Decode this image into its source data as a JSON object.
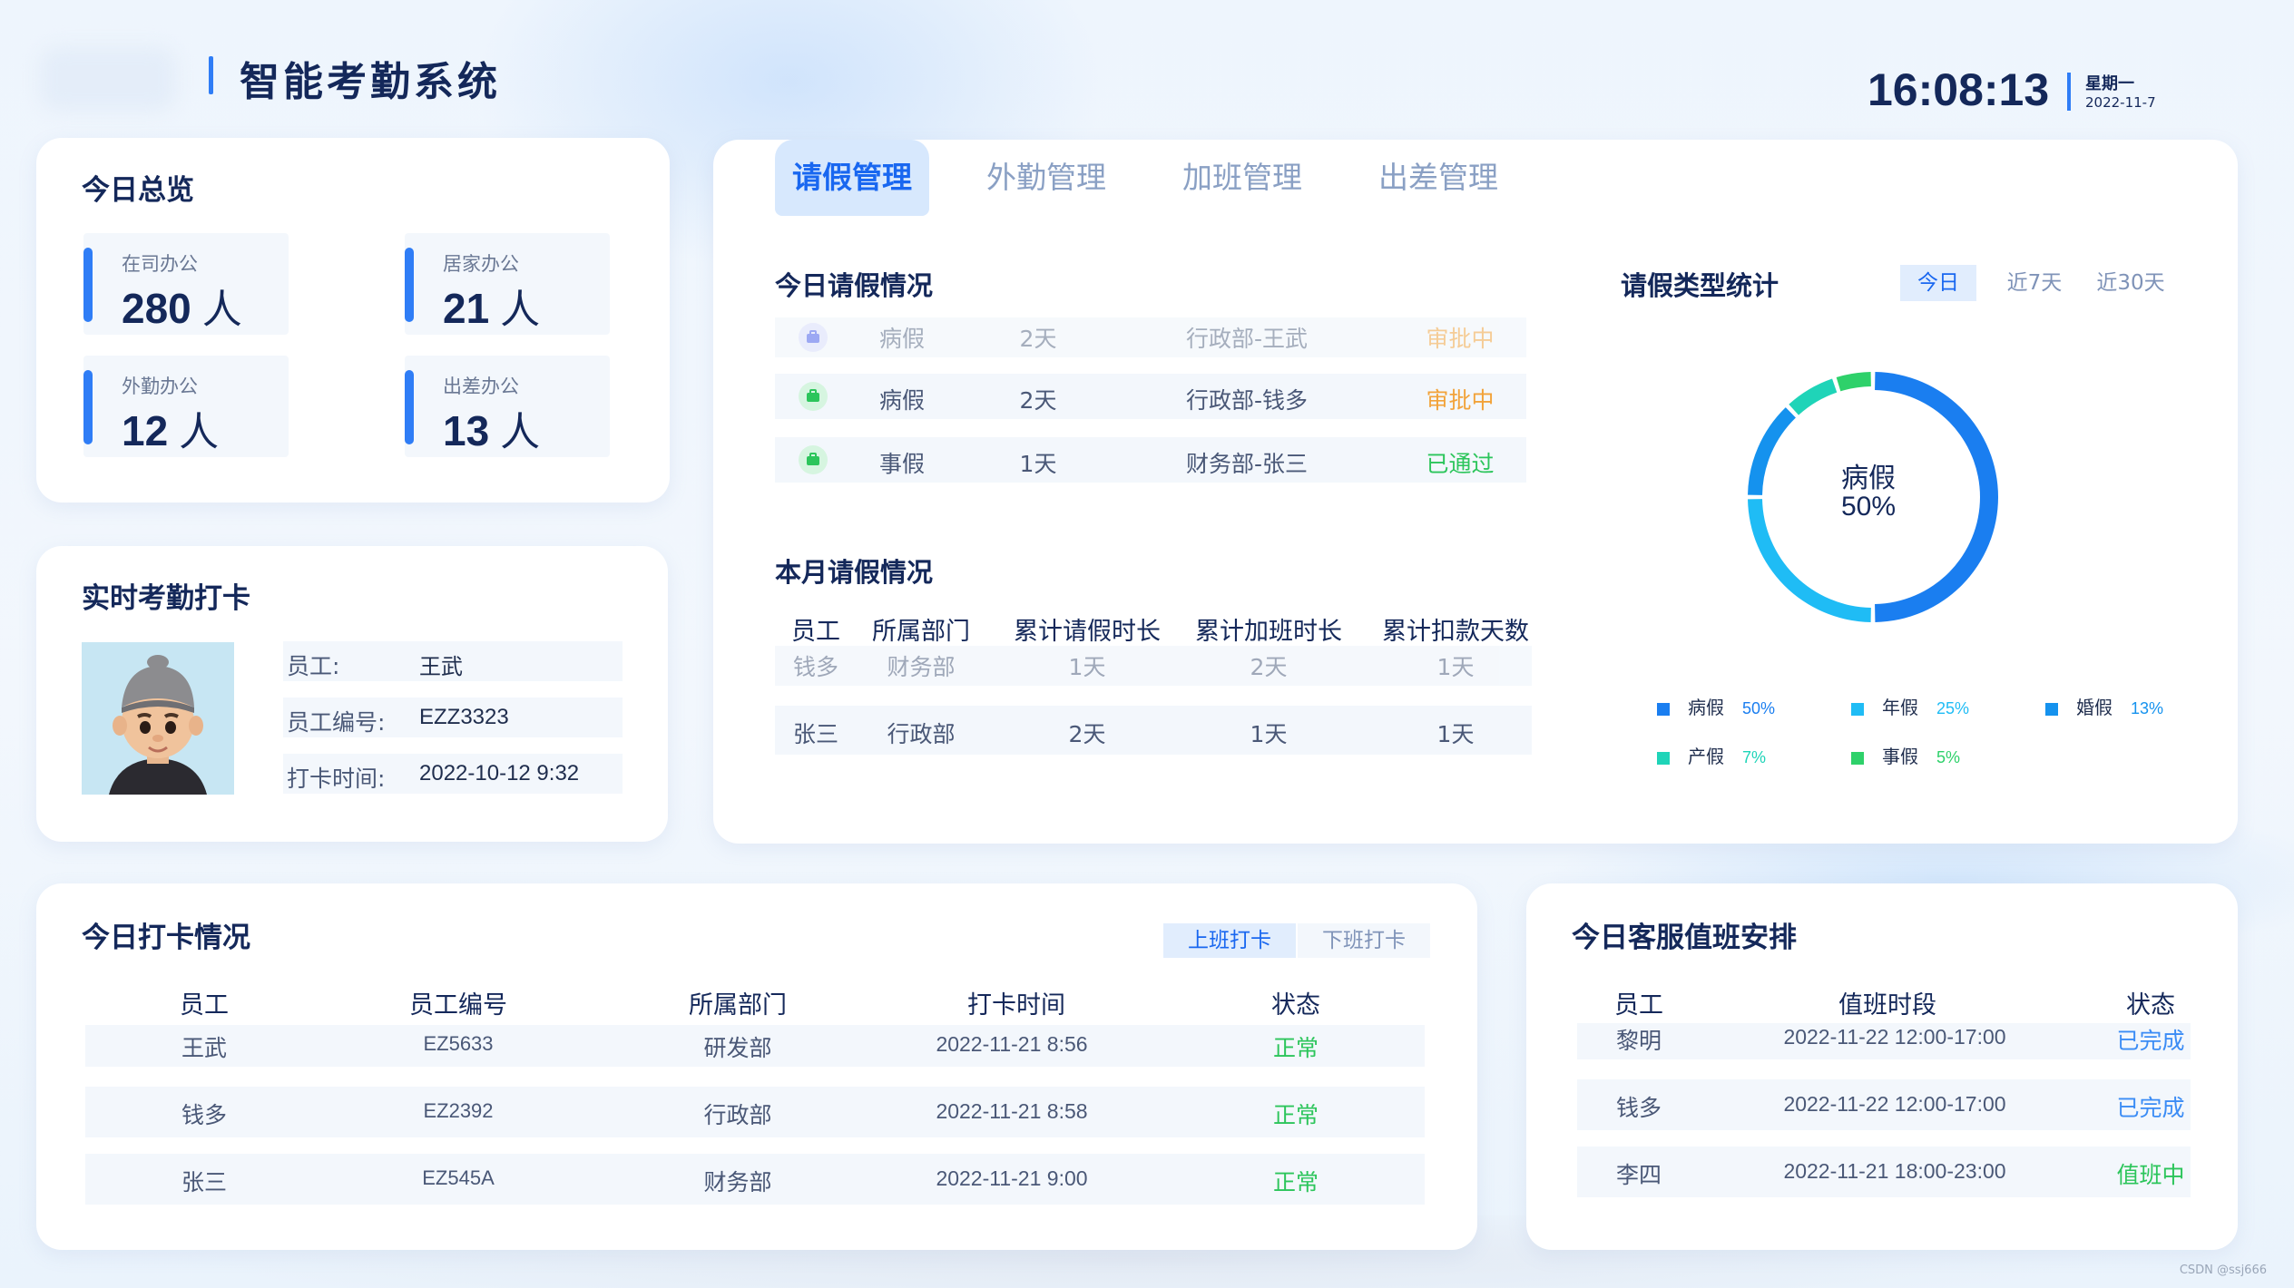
{
  "header": {
    "title": "智能考勤系统",
    "time": "16:08:13",
    "weekday": "星期一",
    "date": "2022-11-7"
  },
  "overview": {
    "title": "今日总览",
    "unit": "人",
    "stats": [
      {
        "label": "在司办公",
        "value": "280"
      },
      {
        "label": "居家办公",
        "value": "21"
      },
      {
        "label": "外勤办公",
        "value": "12"
      },
      {
        "label": "出差办公",
        "value": "13"
      }
    ]
  },
  "realtime": {
    "title": "实时考勤打卡",
    "rows": [
      {
        "key": "员工:",
        "value": "王武"
      },
      {
        "key": "员工编号:",
        "value": "EZZ3323"
      },
      {
        "key": "打卡时间:",
        "value": "2022-10-12 9:32"
      }
    ]
  },
  "tabs": [
    {
      "label": "请假管理",
      "active": true
    },
    {
      "label": "外勤管理",
      "active": false
    },
    {
      "label": "加班管理",
      "active": false
    },
    {
      "label": "出差管理",
      "active": false
    }
  ],
  "today_leave": {
    "title": "今日请假情况",
    "rows": [
      {
        "type": "病假",
        "days": "2天",
        "person": "行政部-王武",
        "status": "审批中"
      },
      {
        "type": "病假",
        "days": "2天",
        "person": "行政部-钱多",
        "status": "审批中"
      },
      {
        "type": "事假",
        "days": "1天",
        "person": "财务部-张三",
        "status": "已通过"
      }
    ]
  },
  "month_leave": {
    "title": "本月请假情况",
    "headers": [
      "员工",
      "所属部门",
      "累计请假时长",
      "累计加班时长",
      "累计扣款天数"
    ],
    "rows": [
      [
        "钱多",
        "财务部",
        "1天",
        "2天",
        "1天"
      ],
      [
        "张三",
        "行政部",
        "2天",
        "1天",
        "1天"
      ]
    ]
  },
  "leave_stats": {
    "title": "请假类型统计",
    "ranges": [
      "今日",
      "近7天",
      "近30天"
    ],
    "active_range": "今日",
    "center_label": "病假",
    "center_value": "50%"
  },
  "chart_data": {
    "type": "pie",
    "categories": [
      "病假",
      "年假",
      "婚假",
      "产假",
      "事假"
    ],
    "values": [
      50,
      25,
      13,
      7,
      5
    ],
    "labels": [
      "50%",
      "25%",
      "13%",
      "7%",
      "5%"
    ],
    "colors": [
      "#1a7ef0",
      "#1fbcf5",
      "#1592ee",
      "#1fd4b8",
      "#2ed16a"
    ],
    "legend": "bottom"
  },
  "checkin": {
    "title": "今日打卡情况",
    "toggle": [
      "上班打卡",
      "下班打卡"
    ],
    "headers": [
      "员工",
      "员工编号",
      "所属部门",
      "打卡时间",
      "状态"
    ],
    "rows": [
      [
        "王武",
        "EZ5633",
        "研发部",
        "2022-11-21 8:56",
        "正常"
      ],
      [
        "钱多",
        "EZ2392",
        "行政部",
        "2022-11-21 8:58",
        "正常"
      ],
      [
        "张三",
        "EZ545A",
        "财务部",
        "2022-11-21 9:00",
        "正常"
      ]
    ]
  },
  "duty": {
    "title": "今日客服值班安排",
    "headers": [
      "员工",
      "值班时段",
      "状态"
    ],
    "rows": [
      [
        "黎明",
        "2022-11-22 12:00-17:00",
        "已完成"
      ],
      [
        "钱多",
        "2022-11-22 12:00-17:00",
        "已完成"
      ],
      [
        "李四",
        "2022-11-21 18:00-23:00",
        "值班中"
      ]
    ]
  },
  "watermark": "CSDN @ssj666"
}
